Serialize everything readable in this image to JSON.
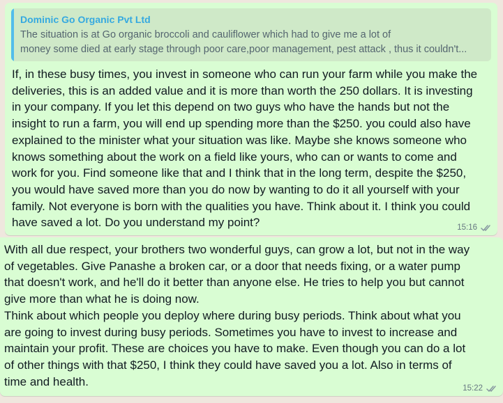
{
  "messages": [
    {
      "quote": {
        "author": "Dominic Go Organic Pvt Ltd",
        "lines": [
          "The situation is at Go organic broccoli and cauliflower which had to give me a lot of",
          "money some died at early stage through poor care,poor management, pest attack , thus it couldn't..."
        ]
      },
      "lines": [
        "If, in these busy times, you invest in someone who can run your farm while you make the",
        "deliveries, this is an added value and it is more than worth the 250 dollars. It is investing",
        "in your company. If you let this depend on two guys who have the hands but not the",
        "insight to run a farm, you will end up spending more than the $250. you could also have",
        "explained to the minister what your situation was like. Maybe she knows someone who",
        "knows something about the work on a field like yours, who can or wants to come and",
        "work for you. Find someone like that and I think that in the long term, despite the $250,",
        "you would have saved more than you do now by wanting to do it all yourself with your",
        "family. Not everyone is born with the qualities you have. Think about it. I think you could",
        "have saved a lot. Do you understand my point?"
      ],
      "time": "15:16",
      "status_icon": "double-check-read-icon"
    },
    {
      "lines": [
        "With all due respect, your brothers two wonderful guys, can grow a lot, but not in the way",
        "of vegetables. Give Panashe a broken car, or a door that needs fixing, or a water pump",
        "that doesn't work, and he'll do it better than anyone else. He tries to help you but cannot",
        "give more than what he is doing now.",
        "Think about which people you deploy where during busy periods. Think about what you",
        "are going to invest during busy periods. Sometimes you have to invest to increase and",
        "maintain your profit. These are choices you have to make. Even though you can do a lot",
        "of other things with that $250, I think they could have saved you a lot. Also in terms of",
        "time and health."
      ],
      "time": "15:22",
      "status_icon": "double-check-read-icon"
    }
  ],
  "colors": {
    "bubble": "#d9fdd3",
    "quote_bar": "#53bdeb",
    "quote_author": "#35a9e0",
    "ticks": "#8696a0"
  }
}
